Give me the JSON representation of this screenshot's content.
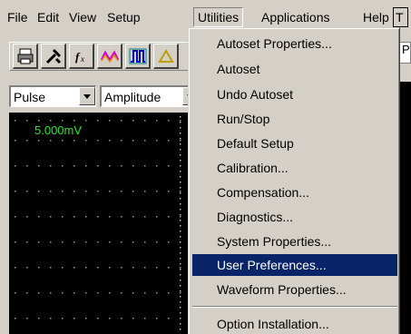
{
  "menubar": {
    "items": [
      "File",
      "Edit",
      "View",
      "Setup",
      "Utilities",
      "Applications",
      "Help",
      "T"
    ],
    "active": "Utilities"
  },
  "toolbar": {
    "buttons": [
      "print-icon",
      "tools-icon",
      "function-icon",
      "waveform-icon",
      "pulse-icon",
      "triangle-icon"
    ],
    "function_glyph": "fx"
  },
  "controls": {
    "combo1_value": "Pulse",
    "combo2_value": "Amplitude"
  },
  "scope": {
    "scale_label": "5.000mV",
    "trace_color": "#2ee62e"
  },
  "right_partial": {
    "text": "P"
  },
  "utilities_menu": {
    "items": [
      "Autoset Properties...",
      "Autoset",
      "Undo Autoset",
      "Run/Stop",
      "Default Setup",
      "Calibration...",
      "Compensation...",
      "Diagnostics...",
      "System Properties...",
      "User Preferences...",
      "Waveform Properties...",
      "Option Installation..."
    ],
    "selected": "User Preferences...",
    "highlight_color": "#0a246a"
  }
}
